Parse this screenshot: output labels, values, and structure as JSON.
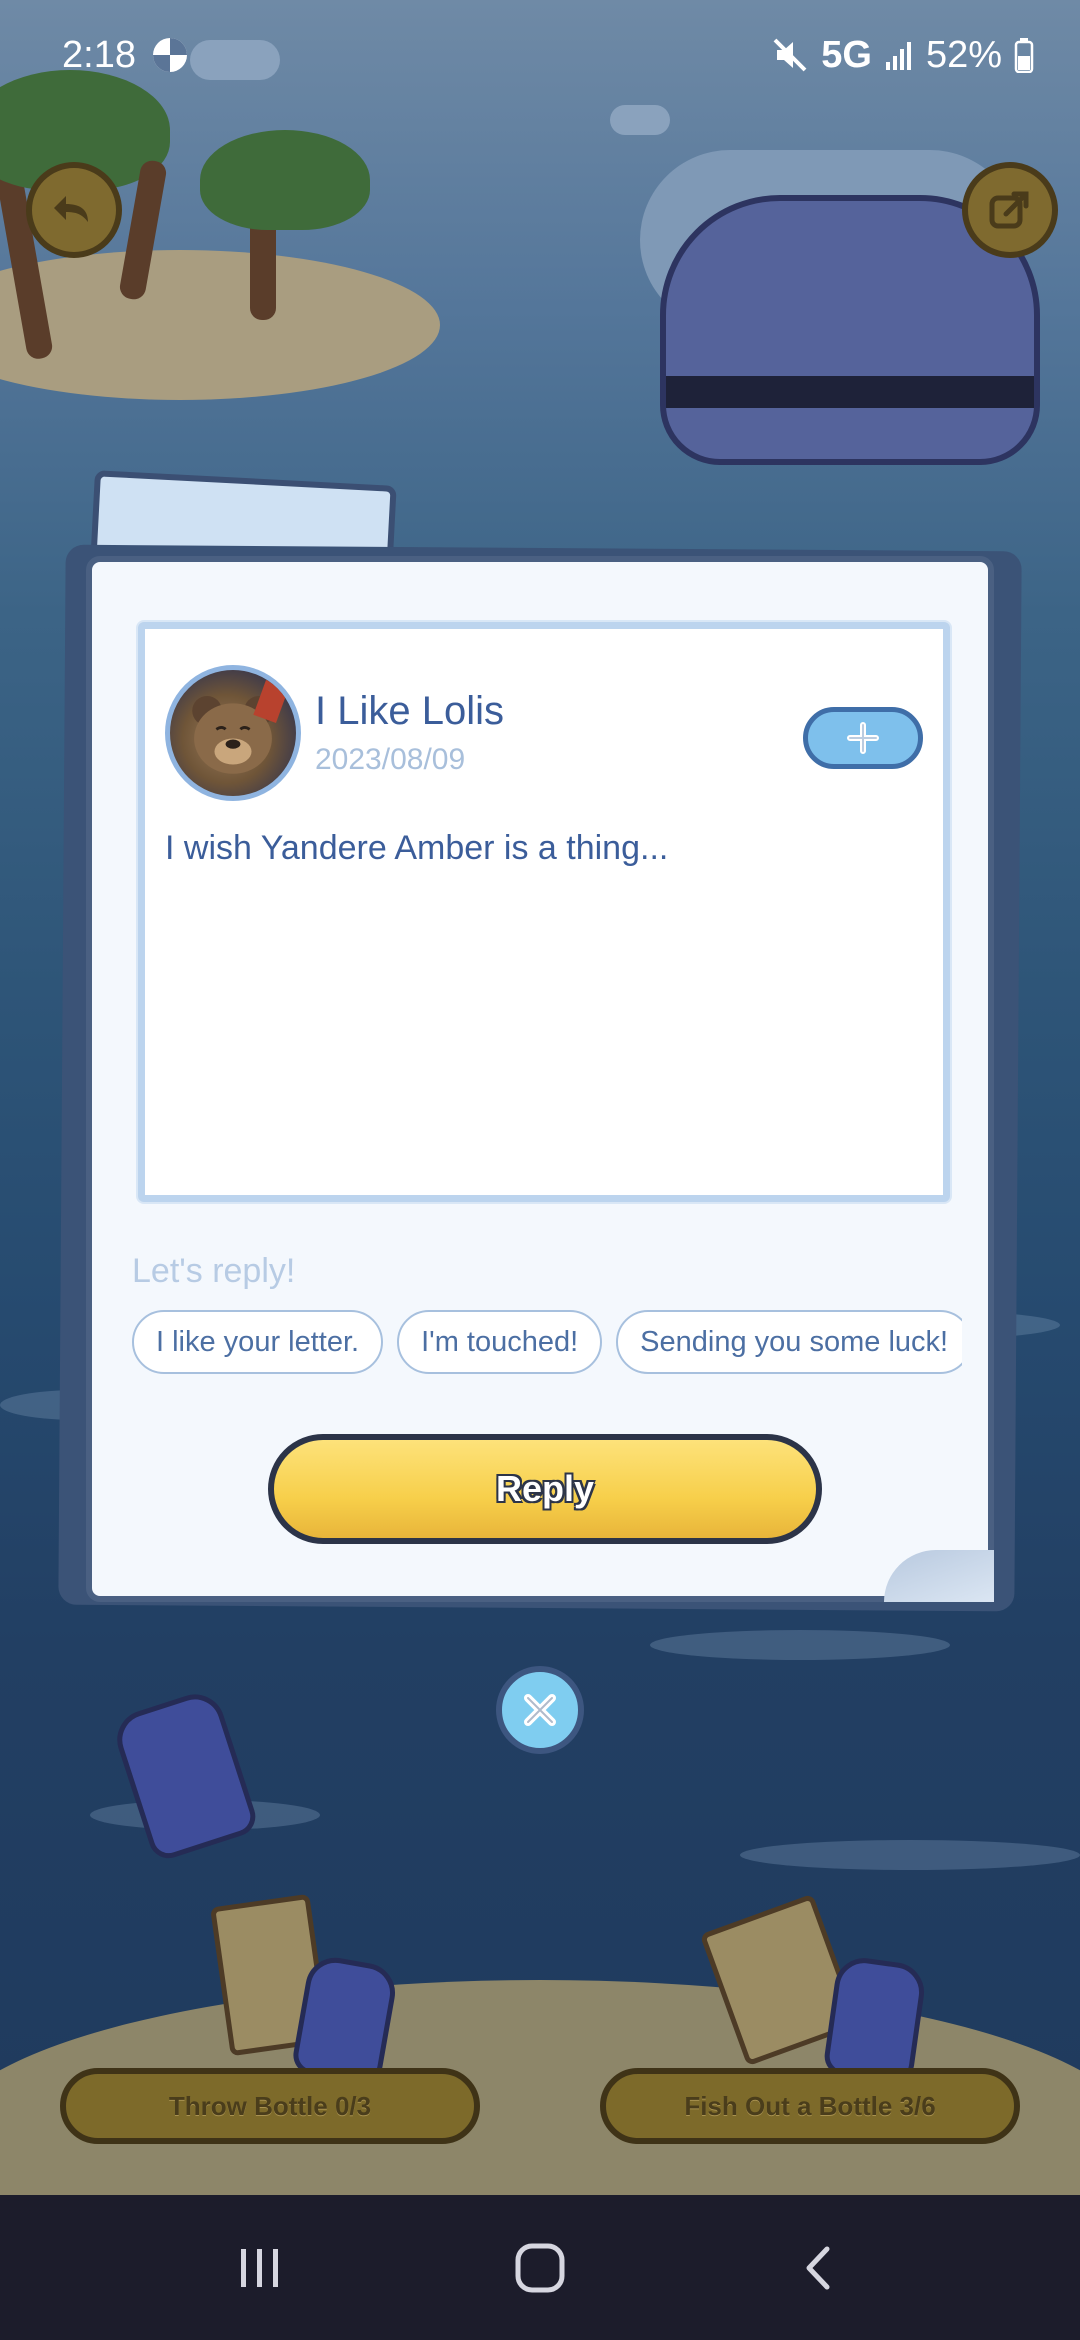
{
  "status_bar": {
    "time": "2:18",
    "network": "5G",
    "battery": "52%"
  },
  "letter": {
    "username": "I Like Lolis",
    "date": "2023/08/09",
    "message": "I wish Yandere Amber is a thing..."
  },
  "reply": {
    "prompt": "Let's reply!",
    "suggestions": [
      "I like your letter.",
      "I'm touched!",
      "Sending you some luck!"
    ],
    "button_label": "Reply"
  },
  "bottom_actions": {
    "throw_label": "Throw Bottle 0/3",
    "fish_label": "Fish Out a Bottle 3/6"
  },
  "colors": {
    "accent_blue": "#3b5d9a",
    "reply_yellow": "#f7cf4a"
  }
}
